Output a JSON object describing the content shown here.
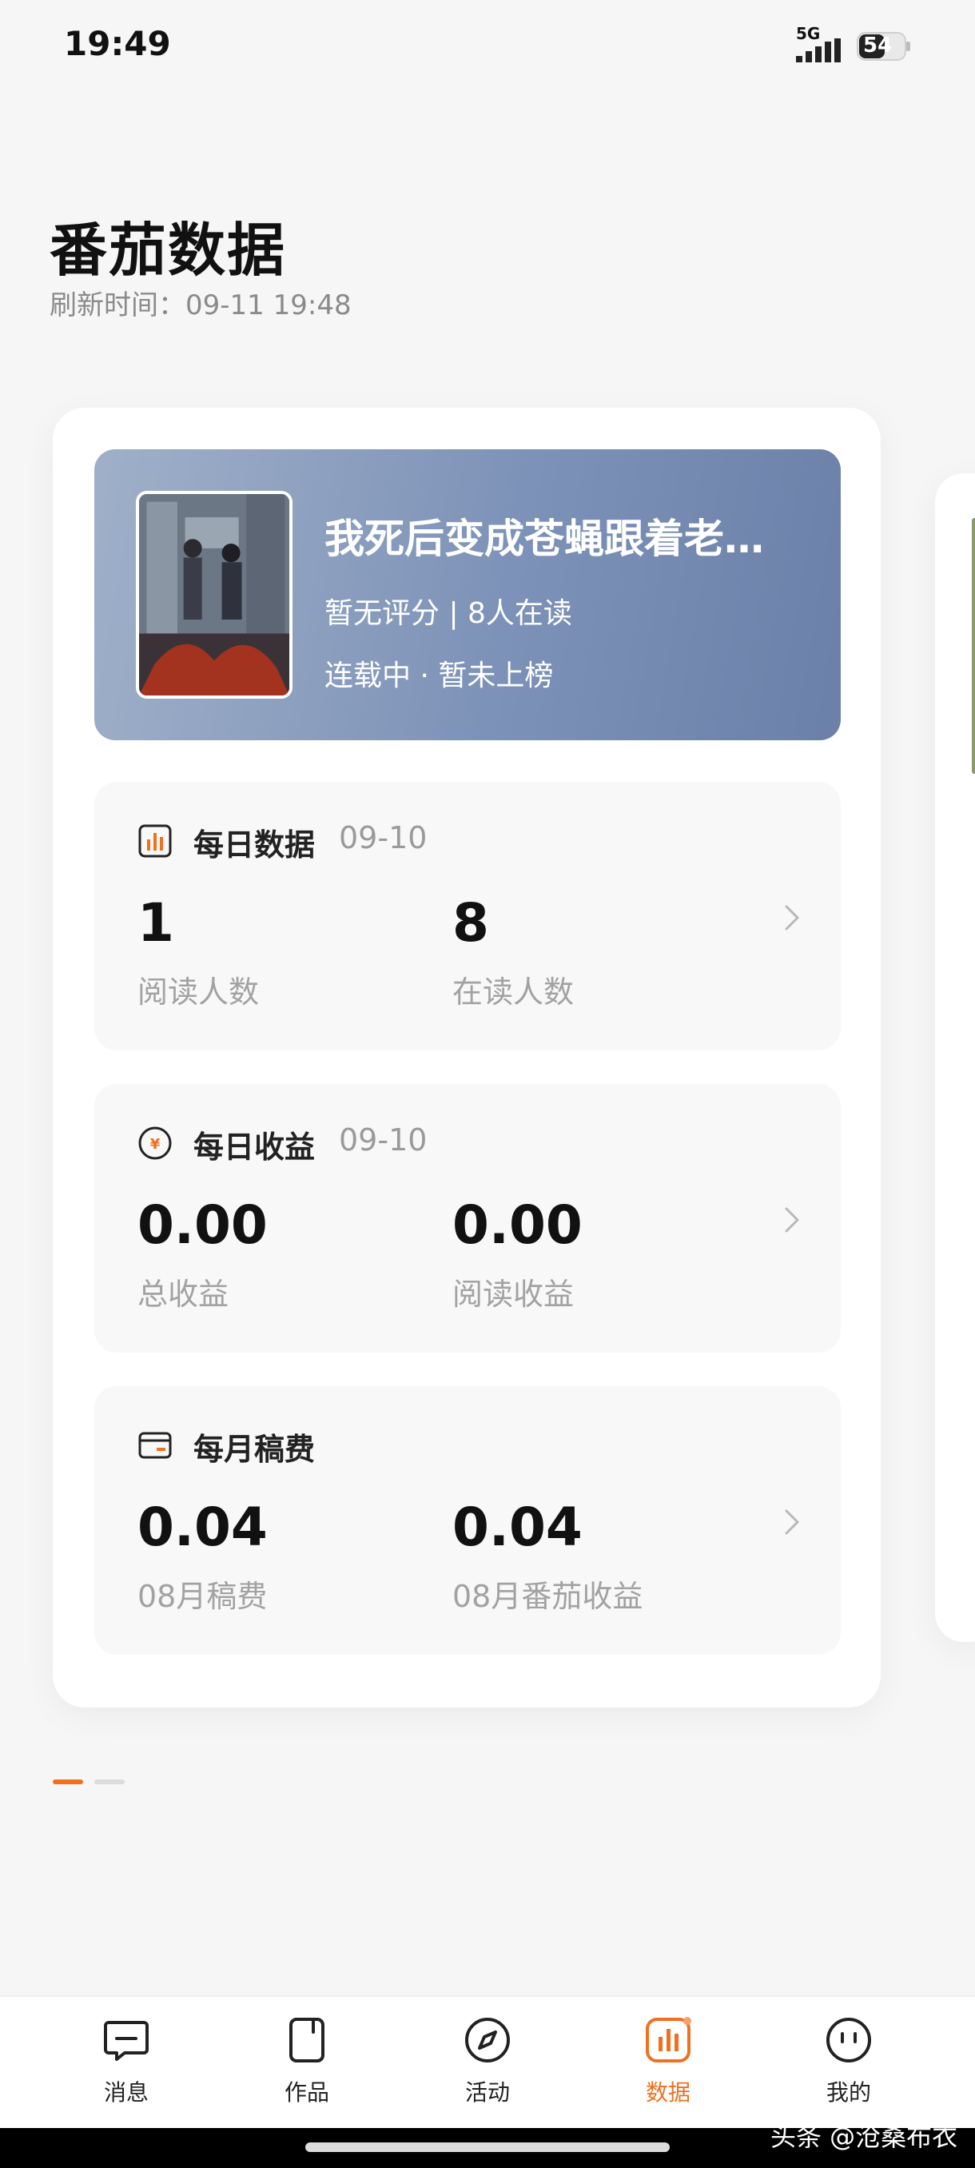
{
  "status_bar": {
    "time": "19:49",
    "network": "5G",
    "battery": "54"
  },
  "header": {
    "title": "番茄数据",
    "refresh_label": "刷新时间：",
    "refresh_time": "09-11 19:48"
  },
  "book": {
    "title": "我死后变成苍蝇跟着老…",
    "rating": "暂无评分",
    "readers": "8人在读",
    "status": "连载中",
    "rank": "暂未上榜"
  },
  "cards": [
    {
      "title": "每日数据",
      "date": "09-10",
      "icon": "bar-chart-icon",
      "metrics": [
        {
          "value": "1",
          "label": "阅读人数"
        },
        {
          "value": "8",
          "label": "在读人数"
        }
      ]
    },
    {
      "title": "每日收益",
      "date": "09-10",
      "icon": "yuan-coin-icon",
      "metrics": [
        {
          "value": "0.00",
          "label": "总收益"
        },
        {
          "value": "0.00",
          "label": "阅读收益"
        }
      ]
    },
    {
      "title": "每月稿费",
      "date": "",
      "icon": "wallet-icon",
      "metrics": [
        {
          "value": "0.04",
          "label": "08月稿费"
        },
        {
          "value": "0.04",
          "label": "08月番茄收益"
        }
      ]
    }
  ],
  "pager": {
    "pages": 2,
    "active": 1
  },
  "nav": [
    {
      "label": "消息",
      "icon": "message-icon",
      "active": false
    },
    {
      "label": "作品",
      "icon": "works-icon",
      "active": false
    },
    {
      "label": "活动",
      "icon": "compass-icon",
      "active": false
    },
    {
      "label": "数据",
      "icon": "data-icon",
      "active": true
    },
    {
      "label": "我的",
      "icon": "profile-icon",
      "active": false
    }
  ],
  "watermark": "头条 @沧桑布衣",
  "colors": {
    "accent": "#f07020",
    "banner": "#7d92b8",
    "background": "#f6f6f6"
  }
}
